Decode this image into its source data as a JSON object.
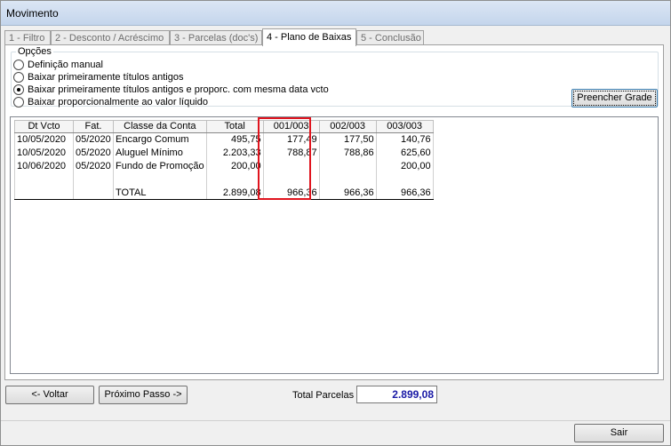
{
  "window": {
    "title": "Movimento"
  },
  "tabs": [
    {
      "label": "1 - Filtro",
      "active": false
    },
    {
      "label": "2 - Desconto / Acréscimo",
      "active": false
    },
    {
      "label": "3 - Parcelas (doc's)",
      "active": false
    },
    {
      "label": "4 - Plano de Baixas",
      "active": true
    },
    {
      "label": "5 - Conclusão",
      "active": false
    }
  ],
  "options": {
    "legend": "Opções",
    "items": [
      {
        "label": "Definição manual",
        "checked": false
      },
      {
        "label": "Baixar primeiramente títulos antigos",
        "checked": false
      },
      {
        "label": "Baixar primeiramente títulos antigos e proporc. com mesma data vcto",
        "checked": true
      },
      {
        "label": "Baixar proporcionalmente ao valor líquido",
        "checked": false
      }
    ]
  },
  "buttons": {
    "preencher": "Preencher Grade",
    "voltar": "<- Voltar",
    "proximo": "Próximo Passo ->",
    "sair": "Sair"
  },
  "grid": {
    "columns": [
      "Dt Vcto",
      "Fat.",
      "Classe da Conta",
      "Total",
      "001/003",
      "002/003",
      "003/003"
    ],
    "rows": [
      [
        "10/05/2020",
        "05/2020",
        "Encargo Comum",
        "495,75",
        "177,49",
        "177,50",
        "140,76"
      ],
      [
        "10/05/2020",
        "05/2020",
        "Aluguel Mínimo",
        "2.203,33",
        "788,87",
        "788,86",
        "625,60"
      ],
      [
        "10/06/2020",
        "05/2020",
        "Fundo de Promoção",
        "200,00",
        "",
        "",
        "200,00"
      ],
      [
        "",
        "",
        "",
        "",
        "",
        "",
        ""
      ],
      [
        "",
        "",
        "TOTAL",
        "2.899,08",
        "966,36",
        "966,36",
        "966,36"
      ]
    ]
  },
  "footer": {
    "total_label": "Total Parcelas",
    "total_value": "2.899,08"
  },
  "colors": {
    "highlight": "#e0141e",
    "total_value": "#1a1aa6"
  }
}
